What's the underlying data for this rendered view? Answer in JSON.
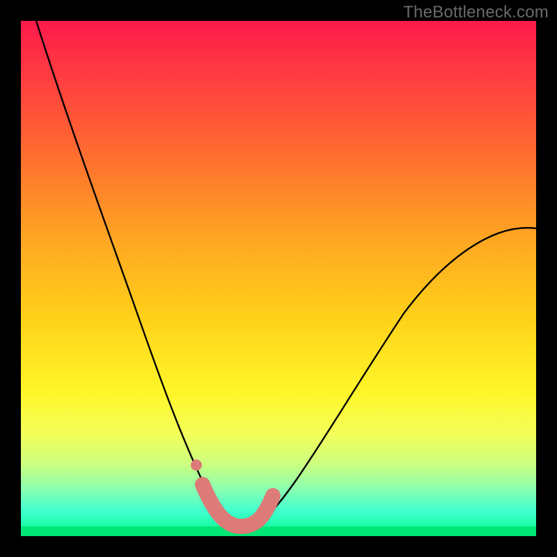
{
  "watermark": "TheBottleneck.com",
  "chart_data": {
    "type": "line",
    "title": "",
    "xlabel": "",
    "ylabel": "",
    "xlim": [
      0,
      1
    ],
    "ylim": [
      0,
      1
    ],
    "grid": false,
    "legend": false,
    "notes": "Bottleneck-style curve on vertical color gradient (red=high bottleneck, green=low). Axes unlabeled; values normalized 0–1. Highlighted pink region near curve minimum.",
    "gradient_stops": [
      {
        "pos": 0.0,
        "color": "#ff1a4b"
      },
      {
        "pos": 0.12,
        "color": "#ff4040"
      },
      {
        "pos": 0.25,
        "color": "#ff6a30"
      },
      {
        "pos": 0.42,
        "color": "#ffa522"
      },
      {
        "pos": 0.58,
        "color": "#ffd21a"
      },
      {
        "pos": 0.72,
        "color": "#fff629"
      },
      {
        "pos": 0.8,
        "color": "#f4ff58"
      },
      {
        "pos": 0.86,
        "color": "#ccff80"
      },
      {
        "pos": 0.91,
        "color": "#88ffb0"
      },
      {
        "pos": 0.95,
        "color": "#42ffd0"
      },
      {
        "pos": 1.0,
        "color": "#00ff90"
      }
    ],
    "series": [
      {
        "name": "bottleneck-curve",
        "color": "#000000",
        "x": [
          0.03,
          0.06,
          0.1,
          0.14,
          0.18,
          0.22,
          0.25,
          0.28,
          0.31,
          0.34,
          0.37,
          0.4,
          0.43,
          0.47,
          0.52,
          0.58,
          0.64,
          0.72,
          0.8,
          0.88,
          0.96,
          1.0
        ],
        "y": [
          1.0,
          0.86,
          0.72,
          0.59,
          0.47,
          0.37,
          0.29,
          0.22,
          0.16,
          0.11,
          0.07,
          0.035,
          0.02,
          0.035,
          0.09,
          0.18,
          0.27,
          0.37,
          0.45,
          0.52,
          0.58,
          0.6
        ]
      },
      {
        "name": "highlight-region",
        "color": "#dd7b78",
        "x": [
          0.35,
          0.37,
          0.4,
          0.43,
          0.46,
          0.48
        ],
        "y": [
          0.1,
          0.05,
          0.02,
          0.02,
          0.05,
          0.09
        ]
      },
      {
        "name": "highlight-dot",
        "color": "#dd7b78",
        "x": [
          0.345
        ],
        "y": [
          0.145
        ]
      }
    ]
  }
}
